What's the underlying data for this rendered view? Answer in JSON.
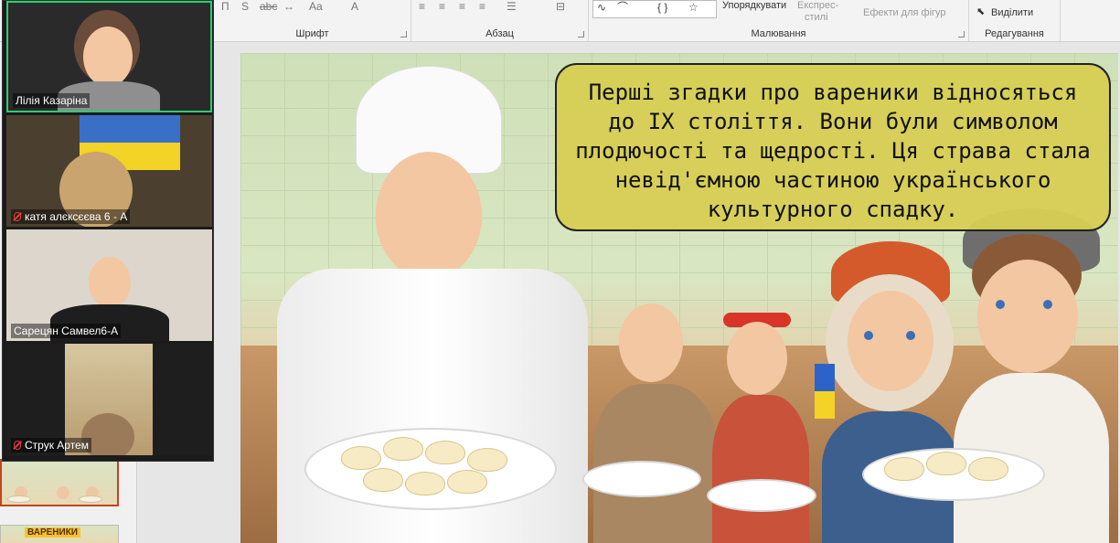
{
  "ribbon": {
    "font_group_label": "Шрифт",
    "paragraph_group_label": "Абзац",
    "drawing_group_label": "Малювання",
    "editing_group_label": "Редагування",
    "arrange_label": "Упорядкувати",
    "quick_styles_label_1": "Експрес-",
    "quick_styles_label_2": "стилі",
    "shape_effects_label": "Ефекти для фігур",
    "select_label": "Виділити",
    "tools": {
      "strikethrough_glyph": "abc",
      "underline_glyph": "П",
      "s_glyph": "S",
      "font_case_glyph": "Aa",
      "font_color_glyph": "A",
      "shapes_glyph": "{ }",
      "star_glyph": "☆"
    }
  },
  "participants": [
    {
      "name": "Лілія Казаріна",
      "muted": false,
      "active": true
    },
    {
      "name": "катя алєксєєва 6 - А",
      "muted": true,
      "active": false
    },
    {
      "name": "Сарецян Самвел6-А",
      "muted": false,
      "active": false
    },
    {
      "name": "Струк Артем",
      "muted": true,
      "active": false
    }
  ],
  "thumbnails": {
    "second_title": "ВАРЕНИКИ"
  },
  "slide": {
    "caption": "Перші згадки про вареники відносяться до IX століття. Вони були символом плодючості та щедрості. Ця страва стала невід'ємною частиною українського культурного спадку."
  },
  "colors": {
    "active_speaker": "#2ecc71",
    "caption_bg": "#d6ce54",
    "muted_mic": "#e23b3b",
    "selected_thumb": "#c4441f"
  }
}
